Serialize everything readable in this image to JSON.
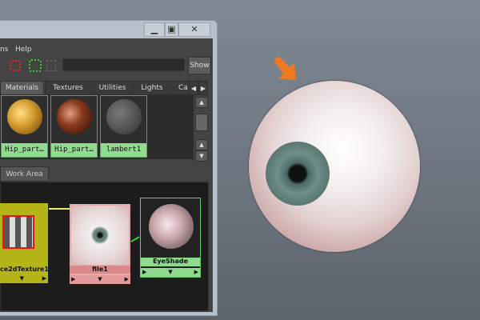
{
  "window": {
    "minimize": "▁",
    "maximize": "▣",
    "close": "✕"
  },
  "menu": {
    "items": [
      "ns",
      "Help"
    ]
  },
  "toolbar": {
    "search_value": "",
    "show_label": "Show"
  },
  "tabs": [
    "Materials",
    "Textures",
    "Utilities",
    "Lights",
    "Ca"
  ],
  "swatches": [
    {
      "label": "Hip_part…",
      "color": "#d8a030"
    },
    {
      "label": "Hip_part…",
      "color": "#8a3a1c"
    },
    {
      "label": "lambert1",
      "color": "#5c5c5c"
    }
  ],
  "work_area": {
    "tab": "Work Area",
    "nodes": [
      {
        "label": "ce2dTexture1"
      },
      {
        "label": "file1"
      },
      {
        "label": "EyeShade"
      }
    ]
  }
}
